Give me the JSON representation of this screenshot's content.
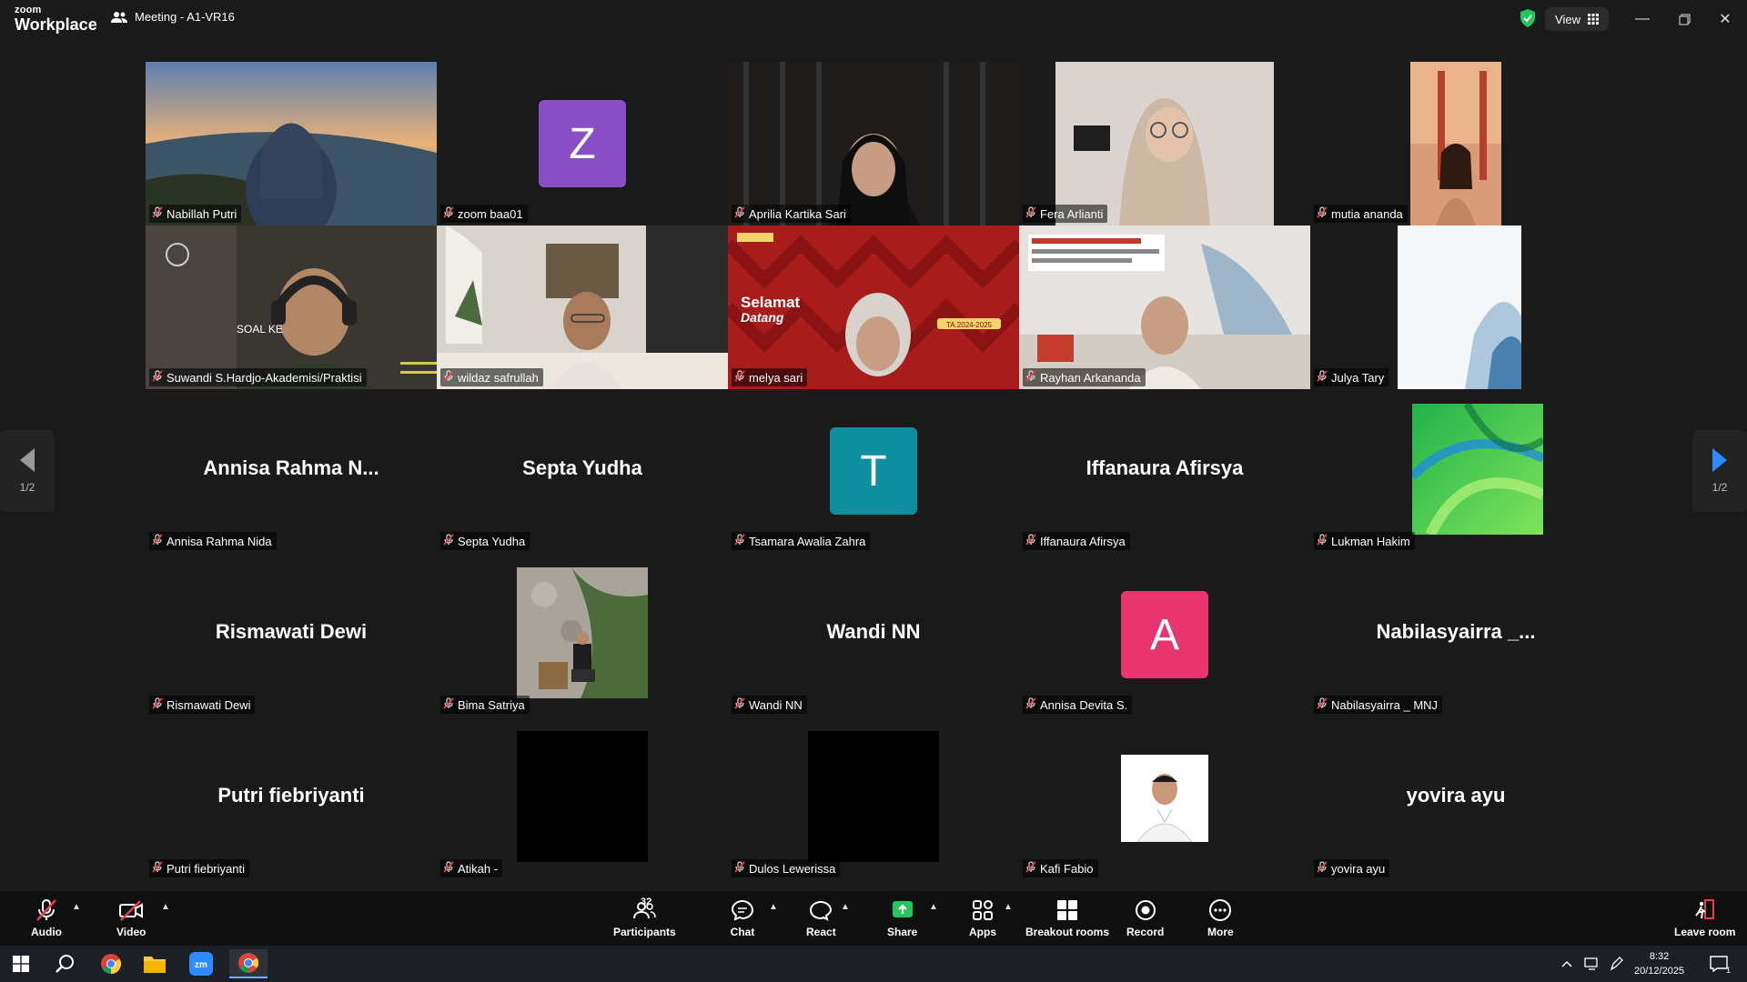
{
  "app": {
    "logo_line1": "zoom",
    "logo_line2": "Workplace",
    "meeting_title": "Meeting - A1-VR16",
    "view_label": "View"
  },
  "participants": [
    {
      "name": "Nabillah Putri",
      "kind": "video",
      "scene": "beach"
    },
    {
      "name": "zoom baa01",
      "kind": "avatar",
      "letter": "Z",
      "avatar_color": "#8a4fc7"
    },
    {
      "name": "Aprilia Kartika Sari",
      "kind": "video",
      "scene": "dark"
    },
    {
      "name": "Fera Arlianti",
      "kind": "video",
      "scene": "room"
    },
    {
      "name": "mutia ananda",
      "kind": "video",
      "scene": "bridge"
    },
    {
      "name": "Suwandi S.Hardjo-Akademisi/Praktisi",
      "kind": "video",
      "scene": "headset",
      "speaking": true,
      "overlay_text": "SOAL KE"
    },
    {
      "name": "wildaz safrullah",
      "kind": "video",
      "scene": "livingroom"
    },
    {
      "name": "melya sari",
      "kind": "video",
      "scene": "redbanner",
      "overlay_title": "Selamat",
      "overlay_sub": "Datang",
      "overlay_year": "TA.2024-2025"
    },
    {
      "name": "Rayhan Arkananda",
      "kind": "video",
      "scene": "office"
    },
    {
      "name": "Julya Tary",
      "kind": "video",
      "scene": "whitepaper"
    },
    {
      "name": "Annisa Rahma Nida",
      "kind": "text",
      "display": "Annisa  Rahma  N..."
    },
    {
      "name": "Septa Yudha",
      "kind": "text",
      "display": "Septa Yudha"
    },
    {
      "name": "Tsamara Awalia Zahra",
      "kind": "avatar",
      "letter": "T",
      "avatar_color": "#0e8fa0"
    },
    {
      "name": "Iffanaura Afirsya",
      "kind": "text",
      "display": "Iffanaura Afirsya"
    },
    {
      "name": "Lukman Hakim",
      "kind": "picture",
      "scene": "greenwave"
    },
    {
      "name": "Rismawati Dewi",
      "kind": "text",
      "display": "Rismawati Dewi"
    },
    {
      "name": "Bima Satriya",
      "kind": "picture",
      "scene": "stonewall"
    },
    {
      "name": "Wandi NN",
      "kind": "text",
      "display": "Wandi NN"
    },
    {
      "name": "Annisa Devita S.",
      "kind": "avatar",
      "letter": "A",
      "avatar_color": "#e8356f"
    },
    {
      "name": "Nabilasyairra _ MNJ",
      "kind": "text",
      "display": "Nabilasyairra  _..."
    },
    {
      "name": "Putri fiebriyanti",
      "kind": "text",
      "display": "Putri fiebriyanti"
    },
    {
      "name": "Atikah -",
      "kind": "picture",
      "scene": "black"
    },
    {
      "name": "Dulos Lewerissa",
      "kind": "picture",
      "scene": "black"
    },
    {
      "name": "Kafi Fabio",
      "kind": "picture",
      "scene": "portrait"
    },
    {
      "name": "yovira ayu",
      "kind": "text",
      "display": "yovira ayu"
    }
  ],
  "pagination": {
    "left": "1/2",
    "right": "1/2"
  },
  "toolbar": {
    "audio": "Audio",
    "video": "Video",
    "participants": "Participants",
    "participants_count": "32",
    "chat": "Chat",
    "react": "React",
    "share": "Share",
    "apps": "Apps",
    "breakout": "Breakout rooms",
    "record": "Record",
    "more": "More",
    "leave": "Leave room"
  },
  "taskbar": {
    "time": "8:32",
    "date": "20/12/2025",
    "notifications": "1"
  },
  "colors": {
    "speaking_border": "#2ed47a",
    "share_green": "#23c55e",
    "muted_red": "#e5414b"
  }
}
